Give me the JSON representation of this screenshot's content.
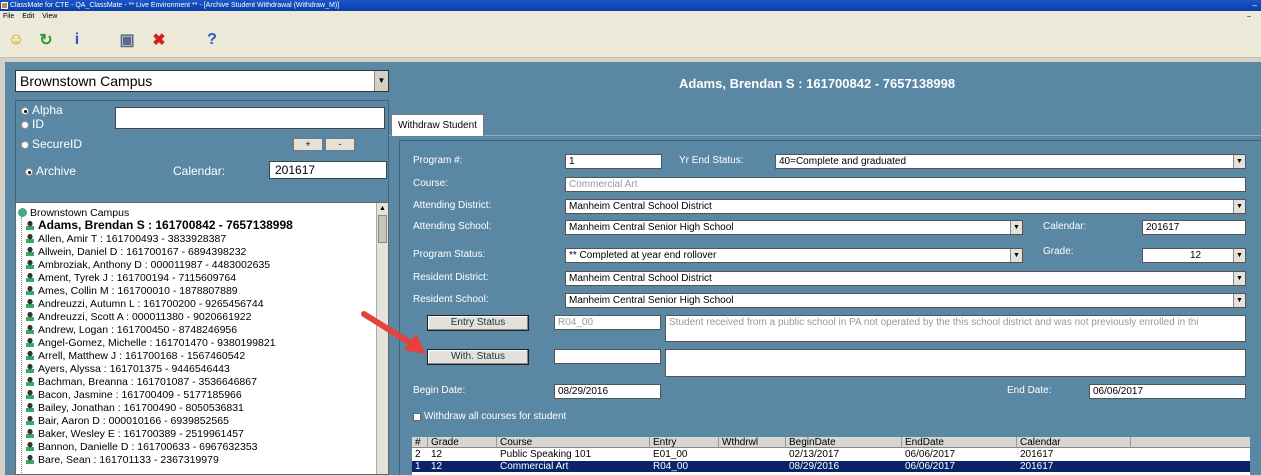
{
  "window": {
    "title": "ClassMate for CTE - QA_ClassMate - ** Live Environment ** - [Archive Student Withdrawal (Withdraw_M)]",
    "minimize": "–",
    "mdi_close": "–"
  },
  "menu": [
    "File",
    "Edit",
    "View"
  ],
  "toolbar": [
    {
      "icon": "smiley-icon",
      "glyph": "☺",
      "color": "#e08a00"
    },
    {
      "icon": "refresh-icon",
      "glyph": "↻",
      "color": "#2e9a2e"
    },
    {
      "icon": "info-icon",
      "glyph": "i",
      "color": "#2a5cc8"
    },
    {
      "icon": "save-icon",
      "glyph": "▣",
      "color": "#5a6a90"
    },
    {
      "icon": "cancel-icon",
      "glyph": "✖",
      "color": "#d02020"
    },
    {
      "icon": "help-icon",
      "glyph": "?",
      "color": "#2a5cc8"
    }
  ],
  "left": {
    "campus": "Brownstown Campus",
    "search_modes": {
      "alpha": "Alpha",
      "id": "ID",
      "secure_id": "SecureID"
    },
    "selected_mode": "alpha",
    "plus": "+",
    "minus": "-",
    "archive_label": "Archive",
    "calendar_label": "Calendar:",
    "calendar_value": "201617",
    "tree_root": "Brownstown Campus",
    "students": [
      "Adams,  Brendan S : 161700842 - 7657138998",
      "Allen, Amir T : 161700493 - 3833928387",
      "Allwein, Daniel D : 161700167 - 6894398232",
      "Ambroziak, Anthony D : 000011987 - 4483002635",
      "Ament, Tyrek J : 161700194 - 7115609764",
      "Ames, Collin M : 161700010 - 1878807889",
      "Andreuzzi, Autumn L : 161700200 - 9265456744",
      "Andreuzzi, Scott A : 000011380 - 9020661922",
      "Andrew, Logan  : 161700450 - 8748246956",
      "Angel-Gomez, Michelle  : 161701470 - 9380199821",
      "Arrell, Matthew J : 161700168 - 1567460542",
      "Ayers, Alyssa  : 161701375 - 9446546443",
      "Bachman, Breanna  : 161701087 - 3536646867",
      "Bacon, Jasmine  : 161700409 - 5177185966",
      "Bailey, Jonathan  : 161700490 - 8050536831",
      "Bair, Aaron D : 000010166 - 6939852565",
      "Baker, Wesley E : 161700389 - 2519961457",
      "Bannon, Danielle D : 161700633 - 6967632353",
      "Bare, Sean  : 161701133 - 2367319979"
    ]
  },
  "right": {
    "student_header": "Adams,  Brendan S : 161700842 - 7657138998",
    "tab": "Withdraw Student",
    "labels": {
      "program": "Program #:",
      "yr_end_status": "Yr End Status:",
      "course": "Course:",
      "attending_district": "Attending District:",
      "attending_school": "Attending School:",
      "calendar": "Calendar:",
      "program_status": "Program Status:",
      "grade": "Grade:",
      "resident_district": "Resident District:",
      "resident_school": "Resident School:",
      "begin_date": "Begin Date:",
      "end_date": "End Date:",
      "withdraw_all": "Withdraw all courses for student"
    },
    "values": {
      "program": "1",
      "yr_end_status": "40=Complete and graduated",
      "course": "Commercial Art",
      "attending_district": "Manheim Central School District",
      "attending_school": "Manheim Central Senior High School",
      "calendar": "201617",
      "program_status": "** Completed at year end rollover",
      "grade": "12",
      "resident_district": "Manheim Central School District",
      "resident_school": "Manheim Central Senior High School",
      "entry_code": "R04_00",
      "entry_desc": "Student received from a public school in PA not operated by the this school district and was not previously enrolled in thi",
      "with_code": "",
      "with_desc": "",
      "begin_date": "08/29/2016",
      "end_date": "06/06/2017"
    },
    "buttons": {
      "entry_status": "Entry Status",
      "with_status": "With. Status"
    },
    "grid": {
      "columns": [
        "#",
        "Grade",
        "Course",
        "Entry",
        "Wthdrwl",
        "BeginDate",
        "EndDate",
        "Calendar"
      ],
      "rows": [
        [
          "2",
          "12",
          "Public Speaking 101",
          "E01_00",
          "",
          "02/13/2017",
          "06/06/2017",
          "201617"
        ],
        [
          "1",
          "12",
          "Commercial Art",
          "R04_00",
          "",
          "08/29/2016",
          "06/06/2017",
          "201617"
        ]
      ],
      "selected_row": 1
    }
  },
  "colors": {
    "panel": "#5a87a4",
    "selection": "#0a246a",
    "arrow": "#e8403a"
  }
}
